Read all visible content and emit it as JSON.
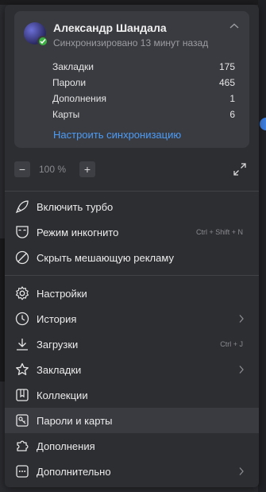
{
  "account": {
    "name": "Александр Шандала",
    "sync_status": "Синхронизировано 13 минут назад",
    "stats": [
      {
        "label": "Закладки",
        "value": "175"
      },
      {
        "label": "Пароли",
        "value": "465"
      },
      {
        "label": "Дополнения",
        "value": "1"
      },
      {
        "label": "Карты",
        "value": "6"
      }
    ],
    "settings_link": "Настроить синхронизацию"
  },
  "zoom": {
    "minus": "−",
    "value": "100 %",
    "plus": "+"
  },
  "menu": {
    "turbo": "Включить турбо",
    "incognito": "Режим инкогнито",
    "incognito_shortcut": "Ctrl + Shift + N",
    "adblock": "Скрыть мешающую рекламу",
    "settings": "Настройки",
    "history": "История",
    "downloads": "Загрузки",
    "downloads_shortcut": "Ctrl + J",
    "bookmarks": "Закладки",
    "collections": "Коллекции",
    "passwords": "Пароли и карты",
    "extensions": "Дополнения",
    "more": "Дополнительно"
  },
  "colors": {
    "accent_link": "#4c9cf6",
    "sync_ok": "#3cb043",
    "menu_bg": "#2d2e32",
    "card_bg": "#3a3b40"
  },
  "icons": {
    "turbo": "rocket-icon",
    "incognito": "mask-icon",
    "adblock": "block-icon",
    "settings": "gear-icon",
    "history": "clock-icon",
    "downloads": "download-icon",
    "bookmarks": "star-icon",
    "collections": "collection-icon",
    "passwords": "key-icon",
    "extensions": "puzzle-icon",
    "more": "more-icon"
  }
}
